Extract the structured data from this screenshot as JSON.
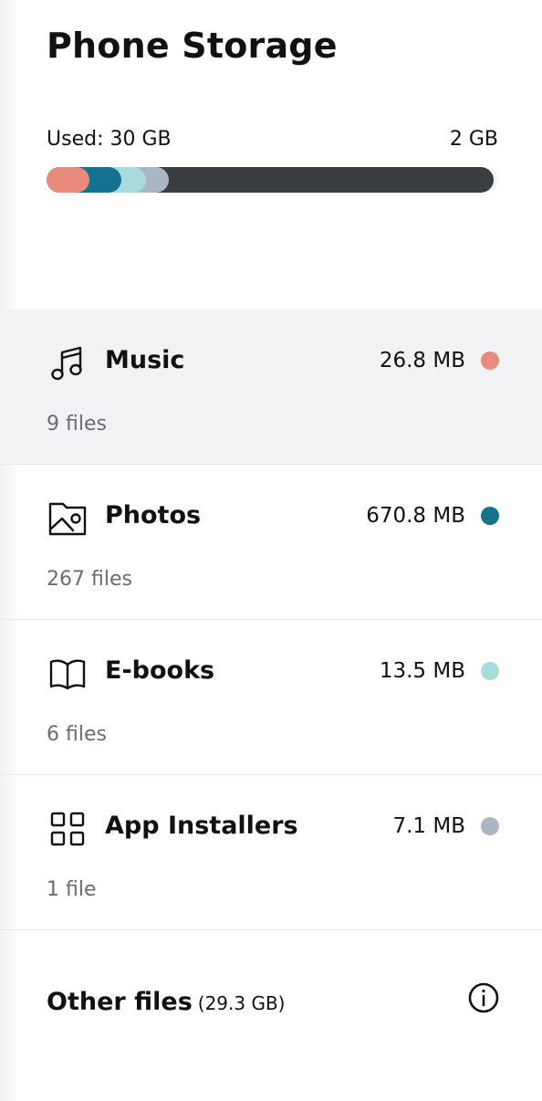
{
  "page": {
    "title": "Phone Storage"
  },
  "usage": {
    "used_label": "Used: 30 GB",
    "free_label": "2 GB",
    "segments": [
      {
        "name": "Music",
        "color": "#e88a7c",
        "fraction": 0.095
      },
      {
        "name": "Photos",
        "color": "#14728e",
        "fraction": 0.07
      },
      {
        "name": "E-books",
        "color": "#a8dcdc",
        "fraction": 0.055
      },
      {
        "name": "App Installers",
        "color": "#aab7c3",
        "fraction": 0.05
      },
      {
        "name": "Other files",
        "color": "#3a3d41",
        "fraction": 0.72
      }
    ]
  },
  "categories": [
    {
      "icon": "music-icon",
      "name": "Music",
      "size": "26.8 MB",
      "files": "9 files",
      "color": "#e88a7c",
      "selected": true
    },
    {
      "icon": "photo-icon",
      "name": "Photos",
      "size": "670.8 MB",
      "files": "267 files",
      "color": "#14728e",
      "selected": false
    },
    {
      "icon": "book-icon",
      "name": "E-books",
      "size": "13.5 MB",
      "files": "6 files",
      "color": "#a8dcdc",
      "selected": false
    },
    {
      "icon": "grid-icon",
      "name": "App Installers",
      "size": "7.1 MB",
      "files": "1 file",
      "color": "#aab7c3",
      "selected": false
    }
  ],
  "other": {
    "label": "Other files",
    "size": "(29.3 GB)",
    "icon": "info-icon"
  }
}
